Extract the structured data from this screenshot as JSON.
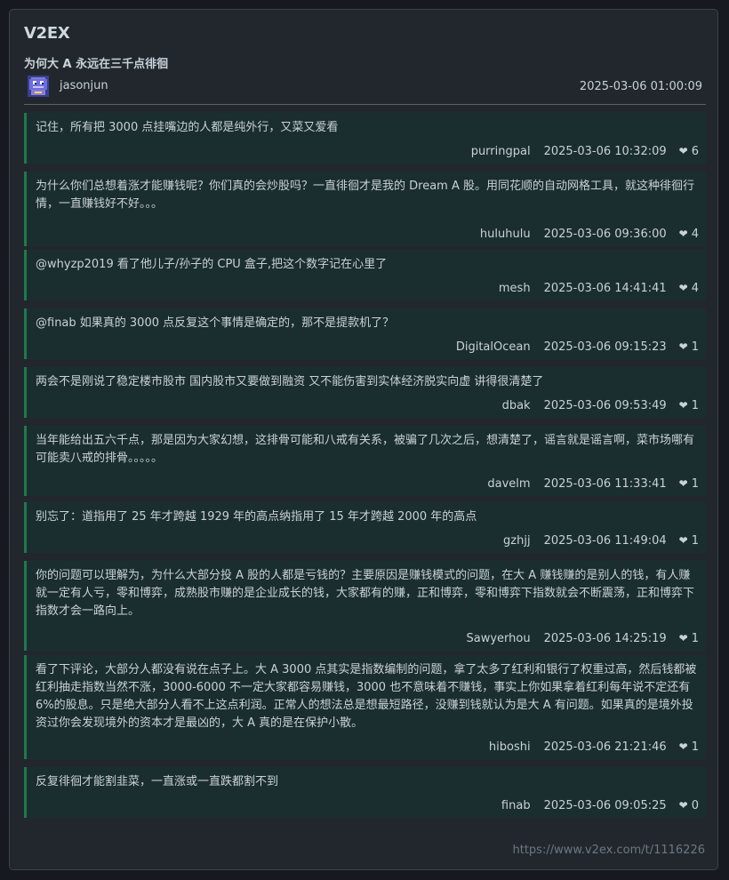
{
  "site": {
    "name": "V2EX"
  },
  "topic": {
    "title": "为何大 A 永远在三千点徘徊",
    "author": "jasonjun",
    "time": "2025-03-06 01:00:09"
  },
  "replies": [
    {
      "text": "记住，所有把 3000 点挂嘴边的人都是纯外行，又菜又爱看",
      "user": "purringpal",
      "time": "2025-03-06 10:32:09",
      "likes": "6"
    },
    {
      "text": "为什么你们总想着涨才能赚钱呢？你们真的会炒股吗？一直徘徊才是我的 Dream A 股。用同花顺的自动网格工具，就这种徘徊行情，一直赚钱好不好。。。",
      "user": "huluhulu",
      "time": "2025-03-06 09:36:00",
      "likes": "4"
    },
    {
      "text": "@whyzp2019 看了他儿子/孙子的 CPU 盒子,把这个数字记在心里了",
      "user": "mesh",
      "time": "2025-03-06 14:41:41",
      "likes": "4"
    },
    {
      "text": "@finab 如果真的 3000 点反复这个事情是确定的，那不是提款机了？",
      "user": "DigitalOcean",
      "time": "2025-03-06 09:15:23",
      "likes": "1"
    },
    {
      "text": "两会不是刚说了稳定楼市股市 国内股市又要做到融资 又不能伤害到实体经济脱实向虚 讲得很清楚了",
      "user": "dbak",
      "time": "2025-03-06 09:53:49",
      "likes": "1"
    },
    {
      "text": "当年能给出五六千点，那是因为大家幻想，这排骨可能和八戒有关系，被骗了几次之后，想清楚了，谣言就是谣言啊，菜市场哪有可能卖八戒的排骨。。。。。",
      "user": "davelm",
      "time": "2025-03-06 11:33:41",
      "likes": "1"
    },
    {
      "text": "别忘了：道指用了 25 年才跨越 1929 年的高点纳指用了 15 年才跨越 2000 年的高点",
      "user": "gzhjj",
      "time": "2025-03-06 11:49:04",
      "likes": "1"
    },
    {
      "text": "你的问题可以理解为，为什么大部分投 A 股的人都是亏钱的？主要原因是赚钱模式的问题，在大 A 赚钱赚的是别人的钱，有人赚就一定有人亏，零和博弈，成熟股市赚的是企业成长的钱，大家都有的赚，正和博弈，零和博弈下指数就会不断震荡，正和博弈下指数才会一路向上。",
      "user": "Sawyerhou",
      "time": "2025-03-06 14:25:19",
      "likes": "1"
    },
    {
      "text": "看了下评论，大部分人都没有说在点子上。大 A 3000 点其实是指数编制的问题，拿了太多了红利和银行了权重过高，然后钱都被红利抽走指数当然不涨，3000-6000 不一定大家都容易赚钱，3000 也不意味着不赚钱，事实上你如果拿着红利每年说不定还有 6%的股息。只是绝大部分人看不上这点利润。正常人的想法总是想最短路径，没赚到钱就认为是大 A 有问题。如果真的是境外投资过你会发现境外的资本才是最凶的，大 A 真的是在保护小散。",
      "user": "hiboshi",
      "time": "2025-03-06 21:21:46",
      "likes": "1"
    },
    {
      "text": "反复徘徊才能割韭菜，一直涨或一直跌都割不到",
      "user": "finab",
      "time": "2025-03-06 09:05:25",
      "likes": "0"
    }
  ],
  "footer": {
    "url": "https://www.v2ex.com/t/1116226"
  },
  "icons": {
    "avatar": "pixel-avatar-icon",
    "like": "heart-icon"
  }
}
